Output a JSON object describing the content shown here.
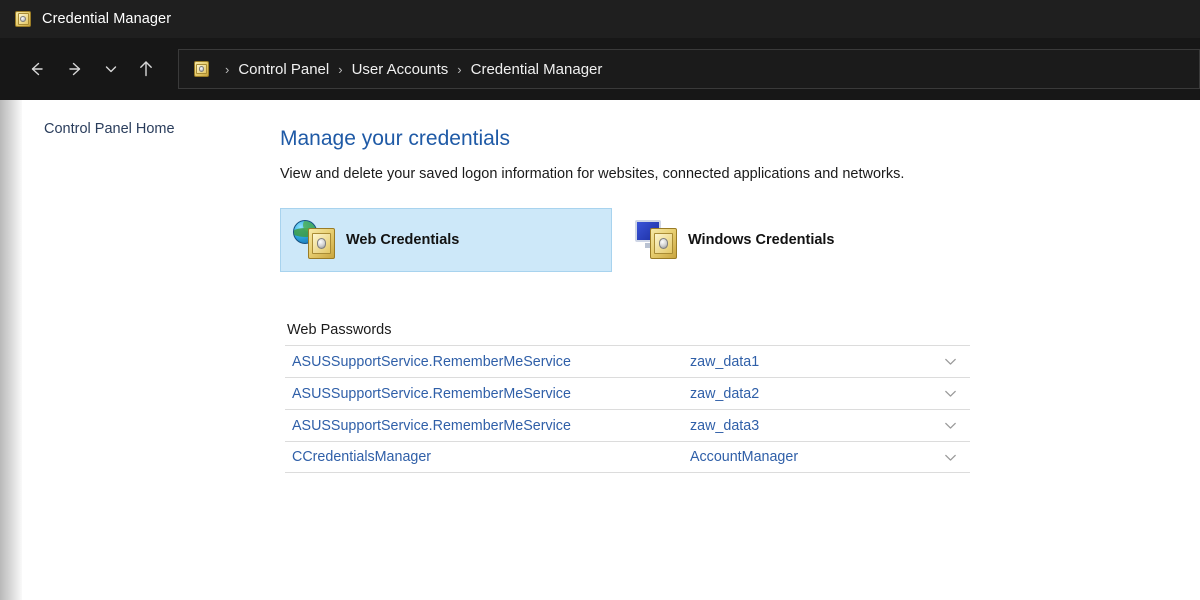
{
  "window": {
    "title": "Credential Manager",
    "icon": "credential-vault-icon"
  },
  "navbar": {
    "back_icon": "arrow-left-icon",
    "forward_icon": "arrow-right-icon",
    "recent_icon": "chevron-down-icon",
    "up_icon": "arrow-up-icon",
    "breadcrumb_icon": "credential-vault-icon",
    "separator": "›",
    "crumbs": [
      {
        "label": "Control Panel"
      },
      {
        "label": "User Accounts"
      },
      {
        "label": "Credential Manager"
      }
    ]
  },
  "sidebar": {
    "home_link": "Control Panel Home"
  },
  "main": {
    "title": "Manage your credentials",
    "subtitle": "View and delete your saved logon information for websites, connected applications and networks.",
    "cards": [
      {
        "label": "Web Credentials",
        "icon": "globe-vault-icon",
        "selected": true
      },
      {
        "label": "Windows Credentials",
        "icon": "monitor-vault-icon",
        "selected": false
      }
    ],
    "table": {
      "caption": "Web Passwords",
      "expand_icon": "chevron-down-icon",
      "rows": [
        {
          "name": "ASUSSupportService.RememberMeService",
          "user": "zaw_data1"
        },
        {
          "name": "ASUSSupportService.RememberMeService",
          "user": "zaw_data2"
        },
        {
          "name": "ASUSSupportService.RememberMeService",
          "user": "zaw_data3"
        },
        {
          "name": "CCredentialsManager",
          "user": "AccountManager"
        }
      ]
    }
  },
  "colors": {
    "titlebar_bg": "#1f1f1f",
    "navbar_bg": "#171717",
    "accent_heading": "#1f5aa6",
    "link": "#2f5fa8",
    "card_selected_bg": "#cde8f9",
    "card_selected_border": "#a8d3ee"
  }
}
